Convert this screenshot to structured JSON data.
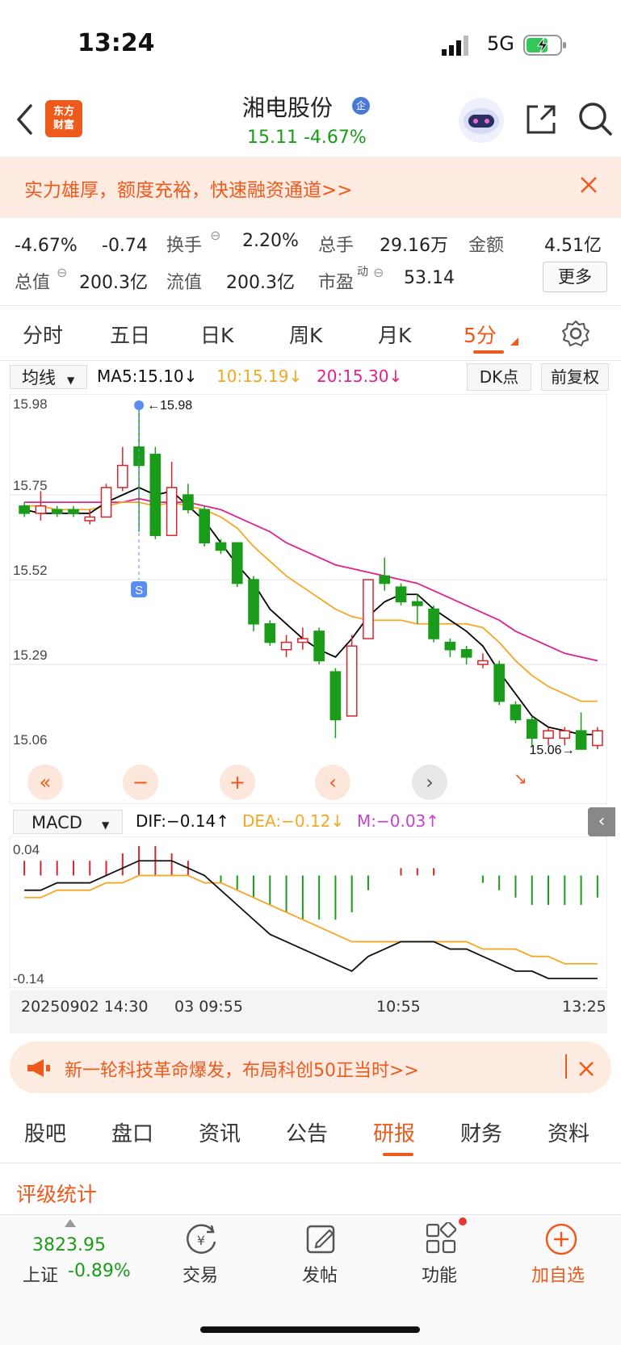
{
  "status_bar": {
    "time": "13:24",
    "network": "5G"
  },
  "header": {
    "logo_text": "东方\n财富",
    "stock_name": "湘电股份",
    "badge": "企",
    "price_line": "15.11  -4.67%"
  },
  "promo_top": {
    "text": "实力雄厚，额度充裕，快速融资通道>>"
  },
  "quote": {
    "change_pct": "-4.67%",
    "change_amt": "-0.74",
    "turnover_label": "换手",
    "turnover": "2.20%",
    "volume_label": "总手",
    "volume": "29.16万",
    "amount_label": "金额",
    "amount": "4.51亿",
    "total_mv_label": "总值",
    "total_mv": "200.3亿",
    "float_mv_label": "流值",
    "float_mv": "200.3亿",
    "pe_label": "市盈",
    "pe_sup": "动",
    "pe": "53.14",
    "more_btn": "更多"
  },
  "tabs": [
    "分时",
    "五日",
    "日K",
    "周K",
    "月K",
    "5分"
  ],
  "ma_row": {
    "select": "均线",
    "ma5": "MA5:15.10↓",
    "ma10": "10:15.19↓",
    "ma20": "20:15.30↓",
    "dk": "DK点",
    "fq": "前复权"
  },
  "macd_row": {
    "select": "MACD",
    "dif": "DIF:−0.14↑",
    "dea": "DEA:−0.12↓",
    "m": "M:−0.03↑"
  },
  "colors": {
    "up": "#d7262b",
    "down": "#1a9c1a",
    "ma5": "#000000",
    "ma10": "#f5a623",
    "ma20": "#e0228c",
    "accent": "#ef5a1c"
  },
  "chart_data": {
    "type": "candlestick",
    "ylim": [
      15.06,
      15.98
    ],
    "y_ticks": [
      "15.98",
      "15.75",
      "15.52",
      "15.29",
      "15.06"
    ],
    "high_marker": "←15.98",
    "low_marker": "15.06→",
    "candles": [
      {
        "o": 15.72,
        "c": 15.7,
        "h": 15.73,
        "l": 15.69
      },
      {
        "o": 15.7,
        "c": 15.72,
        "h": 15.76,
        "l": 15.68
      },
      {
        "o": 15.71,
        "c": 15.7,
        "h": 15.72,
        "l": 15.69
      },
      {
        "o": 15.71,
        "c": 15.7,
        "h": 15.72,
        "l": 15.69
      },
      {
        "o": 15.68,
        "c": 15.69,
        "h": 15.71,
        "l": 15.67
      },
      {
        "o": 15.69,
        "c": 15.77,
        "h": 15.78,
        "l": 15.69
      },
      {
        "o": 15.77,
        "c": 15.83,
        "h": 15.88,
        "l": 15.76
      },
      {
        "o": 15.88,
        "c": 15.83,
        "h": 15.98,
        "l": 15.65
      },
      {
        "o": 15.86,
        "c": 15.64,
        "h": 15.88,
        "l": 15.63
      },
      {
        "o": 15.64,
        "c": 15.77,
        "h": 15.84,
        "l": 15.64
      },
      {
        "o": 15.75,
        "c": 15.71,
        "h": 15.78,
        "l": 15.7
      },
      {
        "o": 15.71,
        "c": 15.62,
        "h": 15.72,
        "l": 15.61
      },
      {
        "o": 15.62,
        "c": 15.6,
        "h": 15.63,
        "l": 15.59
      },
      {
        "o": 15.62,
        "c": 15.51,
        "h": 15.62,
        "l": 15.5
      },
      {
        "o": 15.52,
        "c": 15.4,
        "h": 15.53,
        "l": 15.38
      },
      {
        "o": 15.4,
        "c": 15.35,
        "h": 15.41,
        "l": 15.34
      },
      {
        "o": 15.33,
        "c": 15.35,
        "h": 15.37,
        "l": 15.31
      },
      {
        "o": 15.35,
        "c": 15.36,
        "h": 15.39,
        "l": 15.33
      },
      {
        "o": 15.38,
        "c": 15.3,
        "h": 15.39,
        "l": 15.29
      },
      {
        "o": 15.27,
        "c": 15.14,
        "h": 15.28,
        "l": 15.09
      },
      {
        "o": 15.15,
        "c": 15.34,
        "h": 15.37,
        "l": 15.15
      },
      {
        "o": 15.36,
        "c": 15.52,
        "h": 15.52,
        "l": 15.36
      },
      {
        "o": 15.53,
        "c": 15.51,
        "h": 15.58,
        "l": 15.49
      },
      {
        "o": 15.5,
        "c": 15.46,
        "h": 15.51,
        "l": 15.45
      },
      {
        "o": 15.46,
        "c": 15.45,
        "h": 15.48,
        "l": 15.4
      },
      {
        "o": 15.44,
        "c": 15.36,
        "h": 15.45,
        "l": 15.35
      },
      {
        "o": 15.35,
        "c": 15.33,
        "h": 15.36,
        "l": 15.31
      },
      {
        "o": 15.33,
        "c": 15.31,
        "h": 15.34,
        "l": 15.29
      },
      {
        "o": 15.29,
        "c": 15.3,
        "h": 15.32,
        "l": 15.28
      },
      {
        "o": 15.29,
        "c": 15.19,
        "h": 15.3,
        "l": 15.18
      },
      {
        "o": 15.18,
        "c": 15.14,
        "h": 15.19,
        "l": 15.13
      },
      {
        "o": 15.14,
        "c": 15.09,
        "h": 15.15,
        "l": 15.07
      },
      {
        "o": 15.09,
        "c": 15.11,
        "h": 15.12,
        "l": 15.07
      },
      {
        "o": 15.09,
        "c": 15.11,
        "h": 15.12,
        "l": 15.07
      },
      {
        "o": 15.11,
        "c": 15.06,
        "h": 15.16,
        "l": 15.06
      },
      {
        "o": 15.07,
        "c": 15.11,
        "h": 15.12,
        "l": 15.06
      }
    ],
    "ma5": [
      15.71,
      15.7,
      15.7,
      15.7,
      15.7,
      15.73,
      15.75,
      15.77,
      15.75,
      15.76,
      15.72,
      15.68,
      15.62,
      15.56,
      15.51,
      15.44,
      15.4,
      15.36,
      15.33,
      15.31,
      15.36,
      15.42,
      15.46,
      15.48,
      15.48,
      15.44,
      15.41,
      15.38,
      15.34,
      15.27,
      15.21,
      15.15,
      15.12,
      15.11,
      15.1,
      15.1
    ],
    "ma10": [
      15.72,
      15.72,
      15.71,
      15.71,
      15.71,
      15.72,
      15.73,
      15.73,
      15.72,
      15.73,
      15.72,
      15.71,
      15.69,
      15.66,
      15.61,
      15.57,
      15.53,
      15.5,
      15.47,
      15.44,
      15.42,
      15.41,
      15.41,
      15.41,
      15.4,
      15.4,
      15.4,
      15.4,
      15.39,
      15.35,
      15.3,
      15.26,
      15.23,
      15.21,
      15.19,
      15.19
    ],
    "ma20": [
      15.73,
      15.73,
      15.73,
      15.73,
      15.73,
      15.73,
      15.73,
      15.74,
      15.73,
      15.73,
      15.73,
      15.72,
      15.71,
      15.69,
      15.67,
      15.65,
      15.62,
      15.6,
      15.58,
      15.56,
      15.55,
      15.54,
      15.53,
      15.52,
      15.51,
      15.49,
      15.47,
      15.45,
      15.43,
      15.41,
      15.38,
      15.36,
      15.34,
      15.32,
      15.31,
      15.3
    ],
    "macd": {
      "ylim": [
        -0.14,
        0.04
      ],
      "y_ticks": [
        "0.04",
        "-0.14"
      ],
      "bars": [
        0.02,
        0.02,
        0.02,
        0.02,
        0.02,
        0.02,
        0.03,
        0.04,
        0.04,
        0.03,
        0.02,
        0.0,
        -0.01,
        -0.02,
        -0.03,
        -0.04,
        -0.05,
        -0.06,
        -0.06,
        -0.06,
        -0.05,
        -0.02,
        0.0,
        0.01,
        0.01,
        0.01,
        0.0,
        0.0,
        -0.01,
        -0.02,
        -0.03,
        -0.04,
        -0.04,
        -0.04,
        -0.04,
        -0.03
      ],
      "dif": [
        -0.02,
        -0.02,
        -0.01,
        -0.01,
        -0.01,
        0.0,
        0.01,
        0.02,
        0.02,
        0.02,
        0.01,
        0.0,
        -0.02,
        -0.04,
        -0.06,
        -0.08,
        -0.09,
        -0.1,
        -0.11,
        -0.12,
        -0.13,
        -0.11,
        -0.1,
        -0.09,
        -0.09,
        -0.09,
        -0.1,
        -0.1,
        -0.11,
        -0.12,
        -0.13,
        -0.13,
        -0.14,
        -0.14,
        -0.14,
        -0.14
      ],
      "dea": [
        -0.03,
        -0.03,
        -0.02,
        -0.02,
        -0.02,
        -0.01,
        -0.01,
        0.0,
        0.0,
        0.0,
        0.0,
        -0.01,
        -0.01,
        -0.02,
        -0.03,
        -0.04,
        -0.05,
        -0.06,
        -0.07,
        -0.08,
        -0.09,
        -0.09,
        -0.09,
        -0.09,
        -0.09,
        -0.09,
        -0.09,
        -0.09,
        -0.1,
        -0.1,
        -0.1,
        -0.11,
        -0.11,
        -0.12,
        -0.12,
        -0.12
      ]
    },
    "x_labels": [
      "20250902 14:30",
      "03 09:55",
      "10:55",
      "13:25"
    ]
  },
  "promo_bottom": {
    "text": "新一轮科技革命爆发，布局科创50正当时>>"
  },
  "lower_tabs": [
    "股吧",
    "盘口",
    "资讯",
    "公告",
    "研报",
    "财务",
    "资料"
  ],
  "section_title": "评级统计",
  "bottom_bar": {
    "index_value": "3823.95",
    "index_name": "上证",
    "index_change": "-0.89%",
    "trade": "交易",
    "post": "发帖",
    "func": "功能",
    "add_watch": "加自选"
  }
}
